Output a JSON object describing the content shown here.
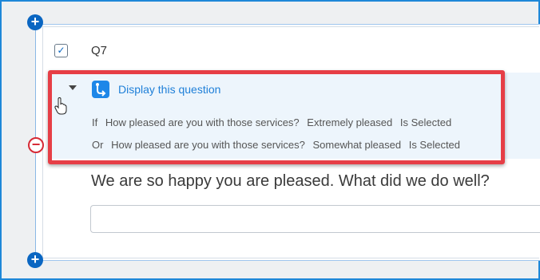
{
  "question": {
    "number": "Q7",
    "text": "We are so happy you are pleased. What did we do well?",
    "input_value": ""
  },
  "logic": {
    "title": "Display this question",
    "conditions": [
      {
        "conjunction": "If",
        "question": "How pleased are you with those services?",
        "answer": "Extremely pleased",
        "operator": "Is Selected"
      },
      {
        "conjunction": "Or",
        "question": "How pleased are you with those services?",
        "answer": "Somewhat pleased",
        "operator": "Is Selected"
      }
    ]
  },
  "icons": {
    "add": "plus-icon",
    "remove": "minus-icon",
    "check": "check-icon",
    "expand": "caret-down-icon",
    "logic": "branch-logic-icon",
    "cursor": "hand-cursor-icon"
  },
  "colors": {
    "accent": "#1e87d8",
    "highlight": "#e63e46",
    "logic_background": "#edf5fc",
    "remove": "#d62a35"
  }
}
